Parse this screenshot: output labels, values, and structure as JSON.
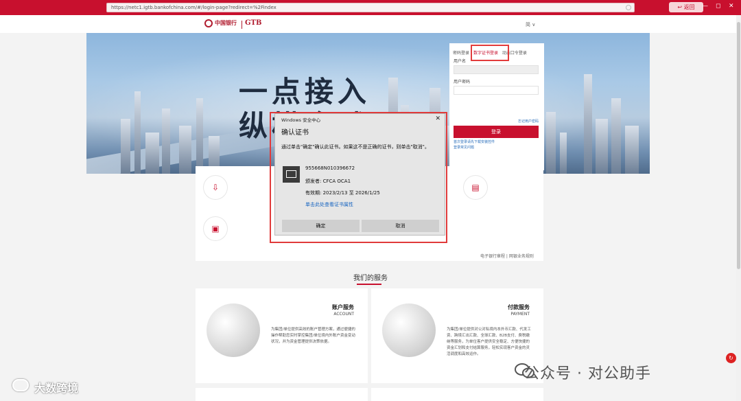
{
  "browser": {
    "url": "https://netc1.igtb.bankofchina.com/#/login-page?redirect=%2Findex",
    "back_label": "返回",
    "min_icon": "—",
    "max_icon": "◻",
    "close_icon": "✕"
  },
  "header": {
    "logo_text": "中国银行",
    "logo_sub": "GTB",
    "lang": "简 ∨"
  },
  "hero": {
    "line1": "一点接入",
    "line2": "纵横全球"
  },
  "login": {
    "tabs": [
      "密码登录",
      "数字证书登录",
      "动态口令登录"
    ],
    "username_label": "用户名",
    "password_label": "用户密码",
    "forgot": "忘记用户密码",
    "login_button": "登录",
    "link1": "首次登录请先下载安装控件",
    "link2": "登录常见问题"
  },
  "footer_links": "电子银行章程  |  网银业务规则",
  "services_title": "我们的服务",
  "cards": [
    {
      "title": "账户服务",
      "subtitle": "ACCOUNT",
      "desc": "为集团/单位提供高效的账户管理方案，通过便捷的操作帮助您实时掌控集团/单位境内外账户资金变动状况，并为资金管理提供决策依据。"
    },
    {
      "title": "付款服务",
      "subtitle": "PAYMENT",
      "desc": "为集团/单位提供对公对私境内本外币汇款、代发工资、跨境汇出汇款、全球汇款、B2B支付、费税缴纳等服务，为单位客户提供安全稳定、方便快捷的资金汇划和支付结算服务，轻松实现客户资金的灵活调度和高效运作。"
    }
  ],
  "dialog": {
    "window_title": "Windows 安全中心",
    "heading": "确认证书",
    "message": "通过单击\"确定\"确认此证书。如果这不是正确的证书，则单击\"取消\"。",
    "cert_id": "955668N010396672",
    "issuer": "颁发者: CFCA OCA1",
    "validity": "有效期: 2023/2/13 至 2026/1/25",
    "view_link": "单击此处查看证书属性",
    "ok_label": "确定",
    "cancel_label": "取消"
  },
  "watermarks": {
    "right": "公众号 · 对公助手",
    "left": "大数跨境"
  }
}
